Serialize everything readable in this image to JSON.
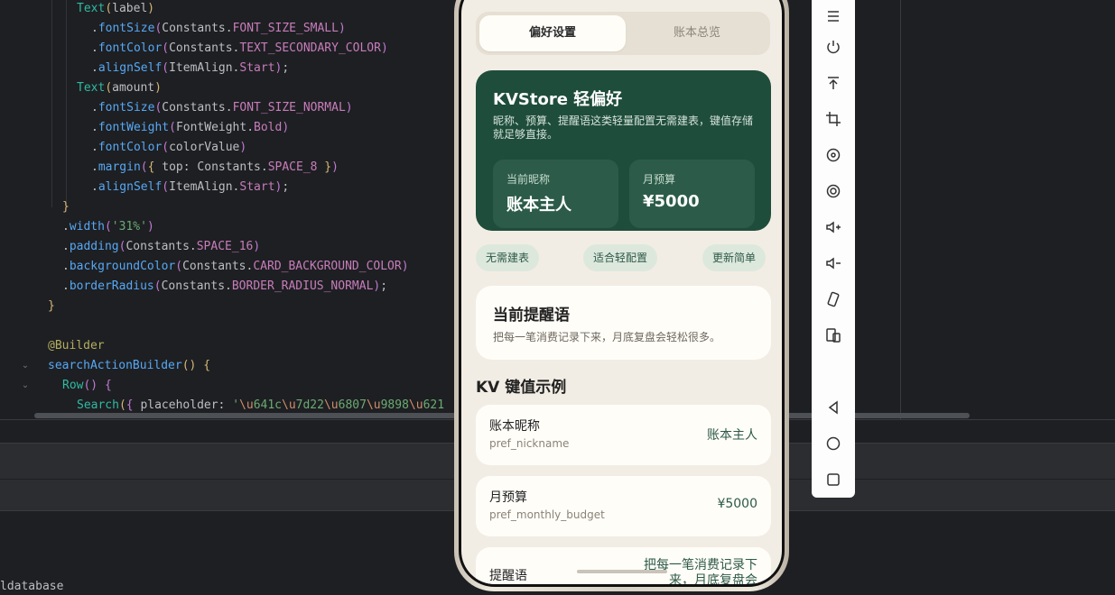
{
  "editor": {
    "lines": [
      {
        "indent": 5,
        "parts": [
          [
            "k-comp",
            "Text"
          ],
          [
            "k-br1",
            "("
          ],
          [
            "k-id",
            "label"
          ],
          [
            "k-br1",
            ")"
          ]
        ]
      },
      {
        "indent": 6,
        "parts": [
          [
            "k-id",
            "."
          ],
          [
            "k-fn",
            "fontSize"
          ],
          [
            "k-br2",
            "("
          ],
          [
            "k-id",
            "Constants."
          ],
          [
            "k-const",
            "FONT_SIZE_SMALL"
          ],
          [
            "k-br2",
            ")"
          ]
        ]
      },
      {
        "indent": 6,
        "parts": [
          [
            "k-id",
            "."
          ],
          [
            "k-fn",
            "fontColor"
          ],
          [
            "k-br2",
            "("
          ],
          [
            "k-id",
            "Constants."
          ],
          [
            "k-const",
            "TEXT_SECONDARY_COLOR"
          ],
          [
            "k-br2",
            ")"
          ]
        ]
      },
      {
        "indent": 6,
        "parts": [
          [
            "k-id",
            "."
          ],
          [
            "k-fn",
            "alignSelf"
          ],
          [
            "k-br2",
            "("
          ],
          [
            "k-id",
            "ItemAlign."
          ],
          [
            "k-const",
            "Start"
          ],
          [
            "k-br2",
            ")"
          ],
          [
            "k-id",
            ";"
          ]
        ]
      },
      {
        "indent": 5,
        "parts": [
          [
            "k-comp",
            "Text"
          ],
          [
            "k-br1",
            "("
          ],
          [
            "k-id",
            "amount"
          ],
          [
            "k-br1",
            ")"
          ]
        ]
      },
      {
        "indent": 6,
        "parts": [
          [
            "k-id",
            "."
          ],
          [
            "k-fn",
            "fontSize"
          ],
          [
            "k-br2",
            "("
          ],
          [
            "k-id",
            "Constants."
          ],
          [
            "k-const",
            "FONT_SIZE_NORMAL"
          ],
          [
            "k-br2",
            ")"
          ]
        ]
      },
      {
        "indent": 6,
        "parts": [
          [
            "k-id",
            "."
          ],
          [
            "k-fn",
            "fontWeight"
          ],
          [
            "k-br2",
            "("
          ],
          [
            "k-id",
            "FontWeight."
          ],
          [
            "k-const",
            "Bold"
          ],
          [
            "k-br2",
            ")"
          ]
        ]
      },
      {
        "indent": 6,
        "parts": [
          [
            "k-id",
            "."
          ],
          [
            "k-fn",
            "fontColor"
          ],
          [
            "k-br2",
            "("
          ],
          [
            "k-id",
            "colorValue"
          ],
          [
            "k-br2",
            ")"
          ]
        ]
      },
      {
        "indent": 6,
        "parts": [
          [
            "k-id",
            "."
          ],
          [
            "k-fn",
            "margin"
          ],
          [
            "k-br2",
            "("
          ],
          [
            "k-br1",
            "{ "
          ],
          [
            "k-id",
            "top: Constants."
          ],
          [
            "k-const",
            "SPACE_8"
          ],
          [
            "k-br1",
            " }"
          ],
          [
            "k-br2",
            ")"
          ]
        ]
      },
      {
        "indent": 6,
        "parts": [
          [
            "k-id",
            "."
          ],
          [
            "k-fn",
            "alignSelf"
          ],
          [
            "k-br2",
            "("
          ],
          [
            "k-id",
            "ItemAlign."
          ],
          [
            "k-const",
            "Start"
          ],
          [
            "k-br2",
            ")"
          ],
          [
            "k-id",
            ";"
          ]
        ]
      },
      {
        "indent": 4,
        "parts": [
          [
            "k-br1",
            "}"
          ]
        ]
      },
      {
        "indent": 4,
        "parts": [
          [
            "k-id",
            "."
          ],
          [
            "k-fn",
            "width"
          ],
          [
            "k-br2",
            "("
          ],
          [
            "k-str",
            "'31%'"
          ],
          [
            "k-br2",
            ")"
          ]
        ]
      },
      {
        "indent": 4,
        "parts": [
          [
            "k-id",
            "."
          ],
          [
            "k-fn",
            "padding"
          ],
          [
            "k-br2",
            "("
          ],
          [
            "k-id",
            "Constants."
          ],
          [
            "k-const",
            "SPACE_16"
          ],
          [
            "k-br2",
            ")"
          ]
        ]
      },
      {
        "indent": 4,
        "parts": [
          [
            "k-id",
            "."
          ],
          [
            "k-fn",
            "backgroundColor"
          ],
          [
            "k-br2",
            "("
          ],
          [
            "k-id",
            "Constants."
          ],
          [
            "k-const",
            "CARD_BACKGROUND_COLOR"
          ],
          [
            "k-br2",
            ")"
          ]
        ]
      },
      {
        "indent": 4,
        "parts": [
          [
            "k-id",
            "."
          ],
          [
            "k-fn",
            "borderRadius"
          ],
          [
            "k-br2",
            "("
          ],
          [
            "k-id",
            "Constants."
          ],
          [
            "k-const",
            "BORDER_RADIUS_NORMAL"
          ],
          [
            "k-br2",
            ")"
          ],
          [
            "k-id",
            ";"
          ]
        ]
      },
      {
        "indent": 3,
        "parts": [
          [
            "k-br1",
            "}"
          ]
        ]
      },
      {
        "indent": 3,
        "parts": []
      },
      {
        "indent": 3,
        "parts": [
          [
            "k-ann",
            "@Builder"
          ]
        ]
      },
      {
        "indent": 3,
        "parts": [
          [
            "k-fn",
            "searchActionBuilder"
          ],
          [
            "k-br1",
            "()"
          ],
          [
            "k-id",
            " "
          ],
          [
            "k-br1",
            "{"
          ]
        ]
      },
      {
        "indent": 4,
        "parts": [
          [
            "k-comp",
            "Row"
          ],
          [
            "k-br2",
            "()"
          ],
          [
            "k-id",
            " "
          ],
          [
            "k-br2",
            "{"
          ]
        ]
      },
      {
        "indent": 5,
        "parts": [
          [
            "k-comp",
            "Search"
          ],
          [
            "k-br1",
            "("
          ],
          [
            "k-br2",
            "{ "
          ],
          [
            "k-id",
            "placeholder: "
          ],
          [
            "k-str",
            "'"
          ],
          [
            "k-esc",
            "\\u"
          ],
          [
            "k-str",
            "641c"
          ],
          [
            "k-esc",
            "\\u"
          ],
          [
            "k-str",
            "7d22"
          ],
          [
            "k-esc",
            "\\u"
          ],
          [
            "k-str",
            "6807"
          ],
          [
            "k-esc",
            "\\u"
          ],
          [
            "k-str",
            "9898"
          ],
          [
            "k-esc",
            "\\u"
          ],
          [
            "k-str",
            "621"
          ]
        ]
      }
    ],
    "console_text": "ldatabase"
  },
  "app": {
    "tabs": {
      "active": "偏好设置",
      "inactive": "账本总览"
    },
    "hero": {
      "title": "KVStore 轻偏好",
      "description": "昵称、预算、提醒语这类轻量配置无需建表，键值存储就足够直接。",
      "nickname_label": "当前昵称",
      "nickname_value": "账本主人",
      "budget_label": "月预算",
      "budget_value": "¥5000"
    },
    "chips": [
      "无需建表",
      "适合轻配置",
      "更新简单"
    ],
    "reminder": {
      "title": "当前提醒语",
      "text": "把每一笔消费记录下来，月底复盘会轻松很多。"
    },
    "kv_section_title": "KV 键值示例",
    "kv_rows": [
      {
        "name": "账本昵称",
        "key": "pref_nickname",
        "value": "账本主人"
      },
      {
        "name": "月预算",
        "key": "pref_monthly_budget",
        "value": "¥5000"
      },
      {
        "name": "提醒语",
        "key": "",
        "value": "把每一笔消费记录下来，月底复盘会"
      }
    ]
  },
  "toolbar": {
    "icons": [
      "menu-icon",
      "power-icon",
      "top-icon",
      "crop-icon",
      "rotate-icon",
      "screenshot-icon",
      "volume-up-icon",
      "volume-down-icon",
      "rotate-device-icon",
      "multi-device-icon",
      "back-icon",
      "home-icon",
      "recents-icon"
    ]
  }
}
